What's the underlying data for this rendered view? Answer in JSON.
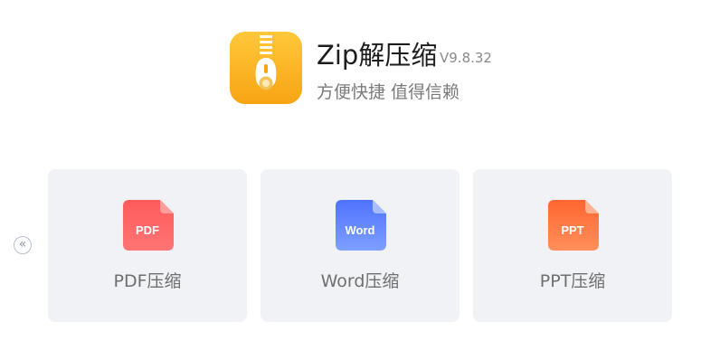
{
  "app": {
    "name": "Zip解压缩",
    "version": "V9.8.32",
    "tagline": "方便快捷 值得信赖"
  },
  "carousel": {
    "prev_glyph": "«",
    "cards": [
      {
        "badge": "PDF",
        "label": "PDF压缩",
        "icon": "pdf-file-icon",
        "colors": [
          "#ff6f6f",
          "#ff4b4b"
        ]
      },
      {
        "badge": "Word",
        "label": "Word压缩",
        "icon": "word-file-icon",
        "colors": [
          "#6e98ff",
          "#4f6fff"
        ]
      },
      {
        "badge": "PPT",
        "label": "PPT压缩",
        "icon": "ppt-file-icon",
        "colors": [
          "#ff8e5a",
          "#ff6a33"
        ]
      }
    ]
  },
  "colors": {
    "app_icon_gradient": [
      "#ffc83a",
      "#f7a414"
    ],
    "card_background": "#f1f2f5"
  }
}
